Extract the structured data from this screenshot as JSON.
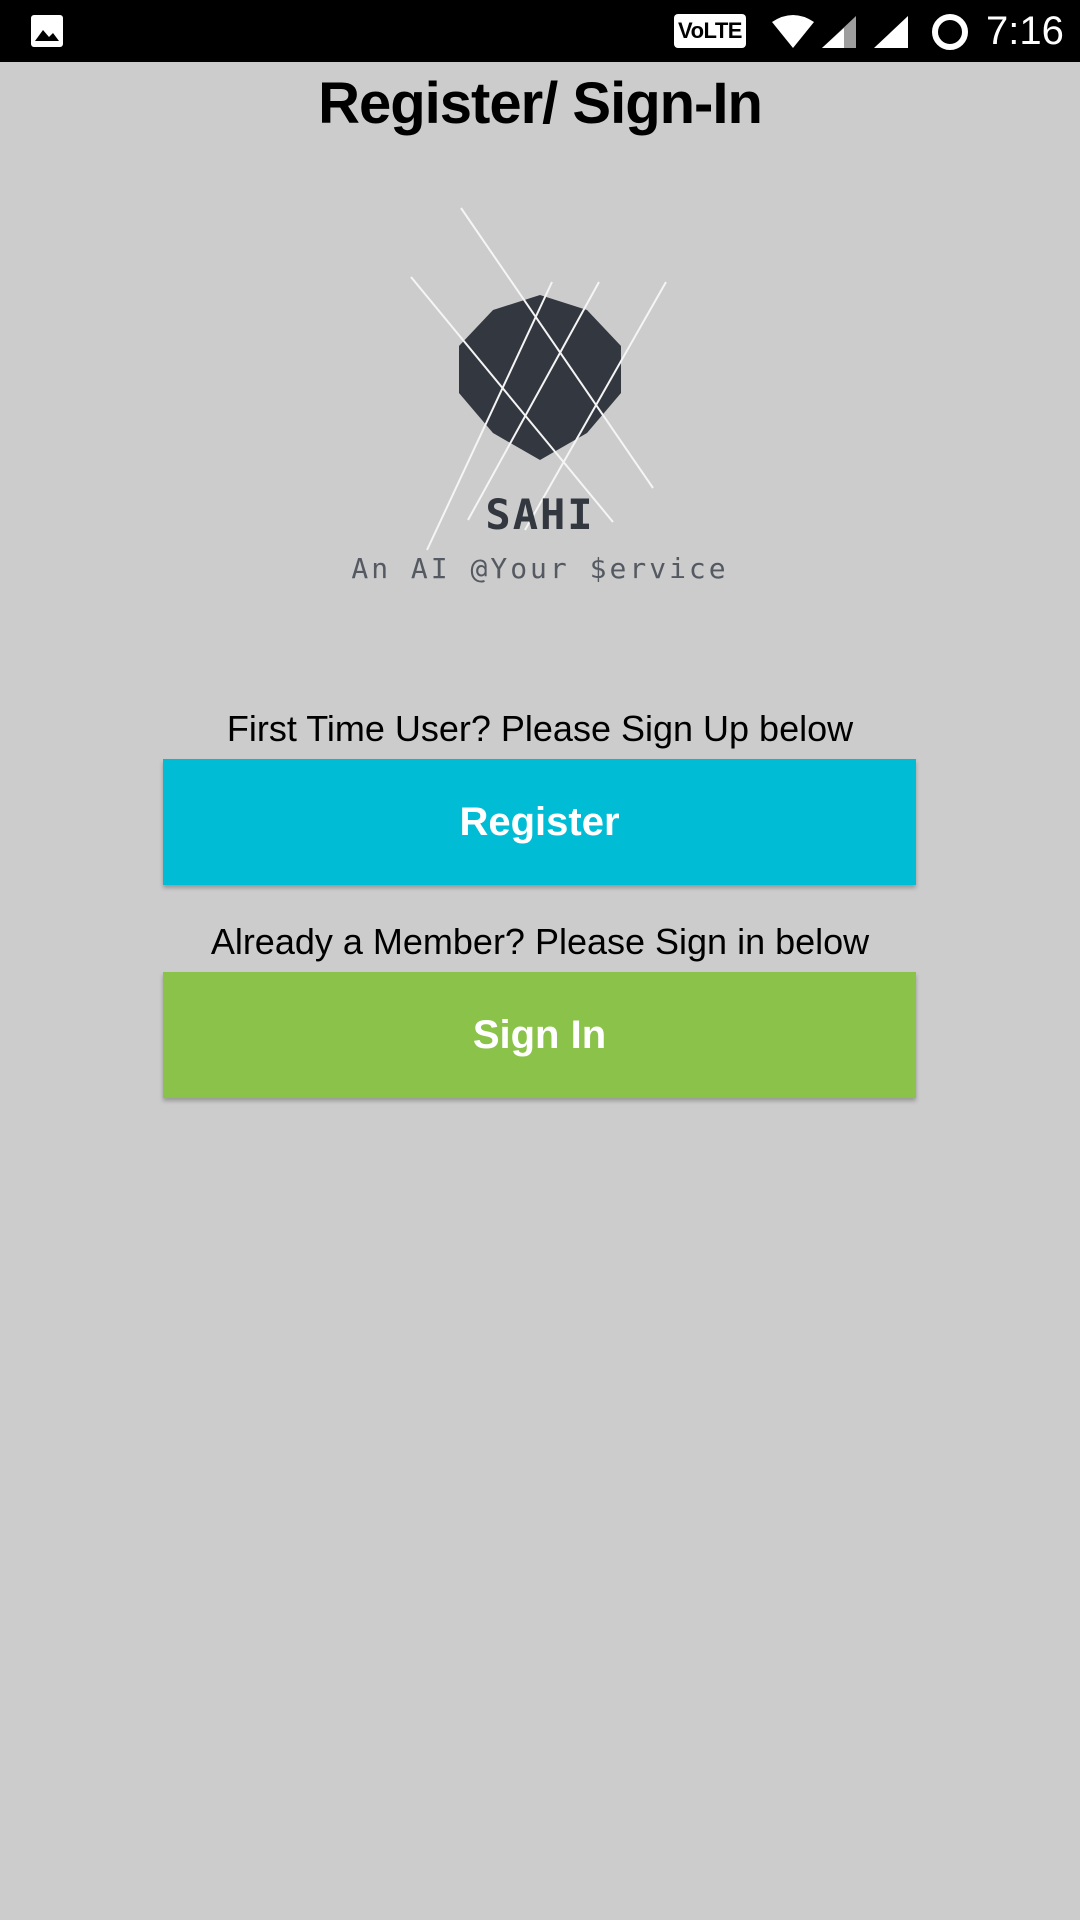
{
  "status_bar": {
    "network_badge": "VoLTE",
    "time": "7:16"
  },
  "page": {
    "title": "Register/ Sign-In"
  },
  "brand": {
    "name": "SAHI",
    "tagline": "An AI @Your $ervice",
    "logo_color": "#33373f"
  },
  "register": {
    "prompt": "First Time User? Please Sign Up below",
    "button_label": "Register",
    "color": "#00bcd4"
  },
  "signin": {
    "prompt": "Already a Member? Please Sign in below",
    "button_label": "Sign In",
    "color": "#8bc34a"
  },
  "icons": [
    "gallery-icon",
    "wifi-icon",
    "signal-icon",
    "loading-icon"
  ]
}
